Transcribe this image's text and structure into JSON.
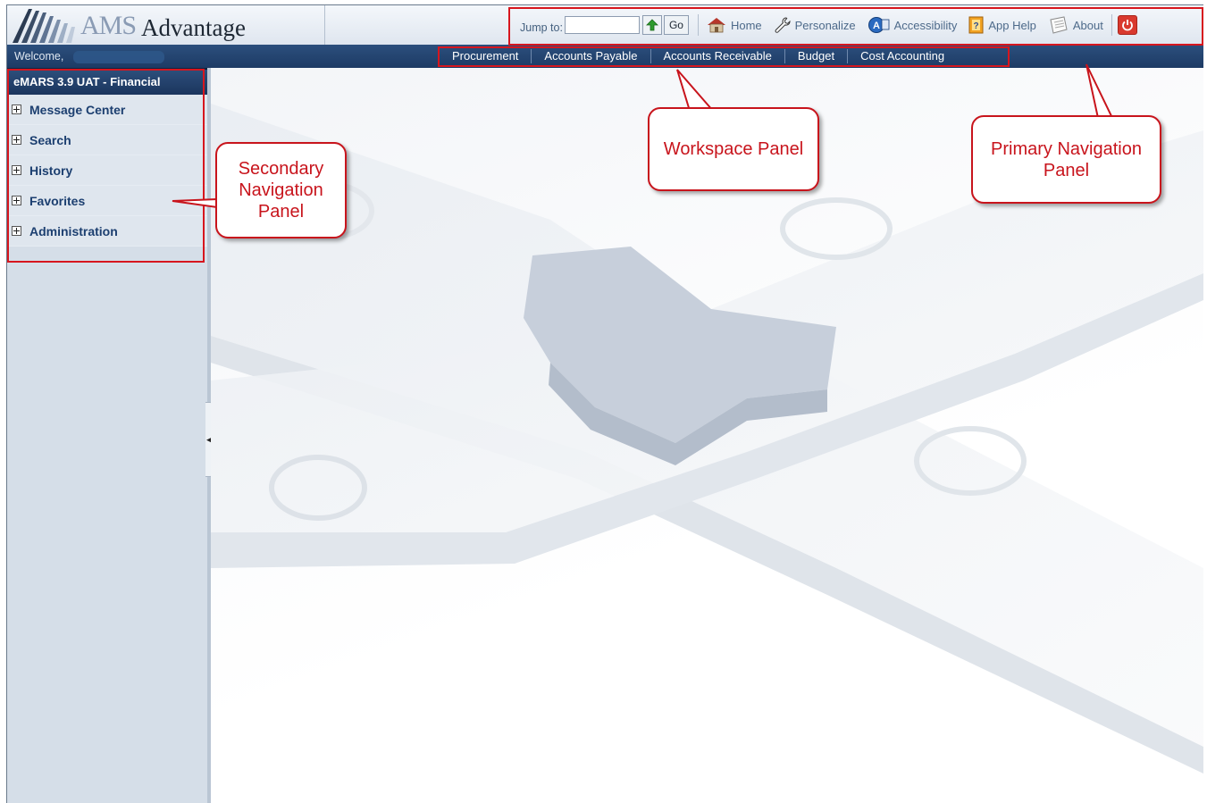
{
  "header": {
    "logo_ams": "AMS",
    "logo_advantage": "Advantage"
  },
  "primary_nav": {
    "jump_label": "Jump to:",
    "jump_value": "",
    "go_label": "Go",
    "items": [
      {
        "label": "Home",
        "icon": "home-icon"
      },
      {
        "label": "Personalize",
        "icon": "wrench-icon"
      },
      {
        "label": "Accessibility",
        "icon": "accessibility-icon"
      },
      {
        "label": "App Help",
        "icon": "help-icon"
      },
      {
        "label": "About",
        "icon": "about-icon"
      }
    ]
  },
  "bar": {
    "welcome": "Welcome,"
  },
  "workspace_nav": {
    "tabs": [
      "Procurement",
      "Accounts Payable",
      "Accounts Receivable",
      "Budget",
      "Cost Accounting"
    ]
  },
  "sidebar": {
    "title": "eMARS 3.9 UAT - Financial",
    "items": [
      "Message Center",
      "Search",
      "History",
      "Favorites",
      "Administration"
    ]
  },
  "callouts": {
    "secondary": "Secondary Navigation Panel",
    "workspace": "Workspace Panel",
    "primary": "Primary Navigation Panel"
  },
  "colors": {
    "accent": "#d7161e",
    "bar": "#1d3b65",
    "sidebar": "#d5dee8",
    "link": "#1c3f70"
  }
}
